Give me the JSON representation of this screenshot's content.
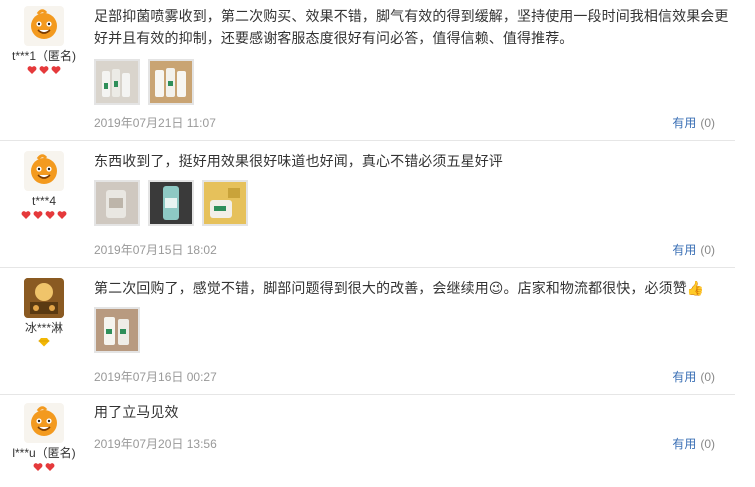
{
  "reviews": [
    {
      "username": "t***1（匿名)",
      "text": "足部抑菌喷雾收到，第二次购买、效果不错，脚气有效的得到缓解，坚持使用一段时间我相信效果会更好并且有效的抑制，还要感谢客服态度很好有问必答，值得信赖、值得推荐。",
      "date": "2019年07月21日 11:07",
      "useful_label": "有用",
      "useful_count": "(0)",
      "level_icon": "heart-icon",
      "level_count": 3,
      "photo_count": 2
    },
    {
      "username": "t***4",
      "text": "东西收到了，挺好用效果很好味道也好闻，真心不错必须五星好评",
      "date": "2019年07月15日 18:02",
      "useful_label": "有用",
      "useful_count": "(0)",
      "level_icon": "heart-icon",
      "level_count": 4,
      "photo_count": 3
    },
    {
      "username": "冰***淋",
      "text": "第二次回购了，感觉不错，脚部问题得到很大的改善，会继续用😉。店家和物流都很快，必须赞👍",
      "date": "2019年07月16日 00:27",
      "useful_label": "有用",
      "useful_count": "(0)",
      "level_icon": "diamond-icon",
      "level_count": 1,
      "photo_count": 1
    },
    {
      "username": "l***u（匿名)",
      "text": "用了立马见效",
      "date": "2019年07月20日 13:56",
      "useful_label": "有用",
      "useful_count": "(0)",
      "level_icon": "heart-icon",
      "level_count": 2,
      "photo_count": 0
    }
  ],
  "colors": {
    "link": "#3a6fb5",
    "meta": "#999999",
    "divider": "#e6e6e6",
    "heart": "#e5393b",
    "diamond": "#f2b705",
    "avatar_orange": "#f39a1f"
  }
}
